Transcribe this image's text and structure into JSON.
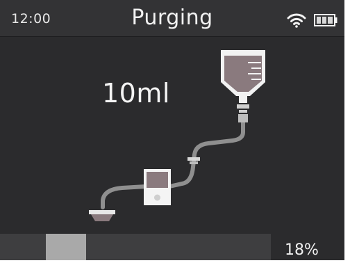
{
  "status_bar": {
    "time": "12:00",
    "title": "Purging",
    "wifi_icon": "wifi-icon",
    "battery_icon": "battery-icon"
  },
  "main": {
    "volume": "10ml",
    "illustration_icons": [
      "iv-bag-icon",
      "tube-connector-icon",
      "pump-device-icon",
      "tray-icon"
    ]
  },
  "progress": {
    "percent_label": "18%",
    "value": 0.18
  },
  "colors": {
    "screen_background": "#2b2b2d",
    "text": "#f2f2f2",
    "progress_fill": "#a9a9a9",
    "bag_fluid": "#8a7a7e"
  }
}
